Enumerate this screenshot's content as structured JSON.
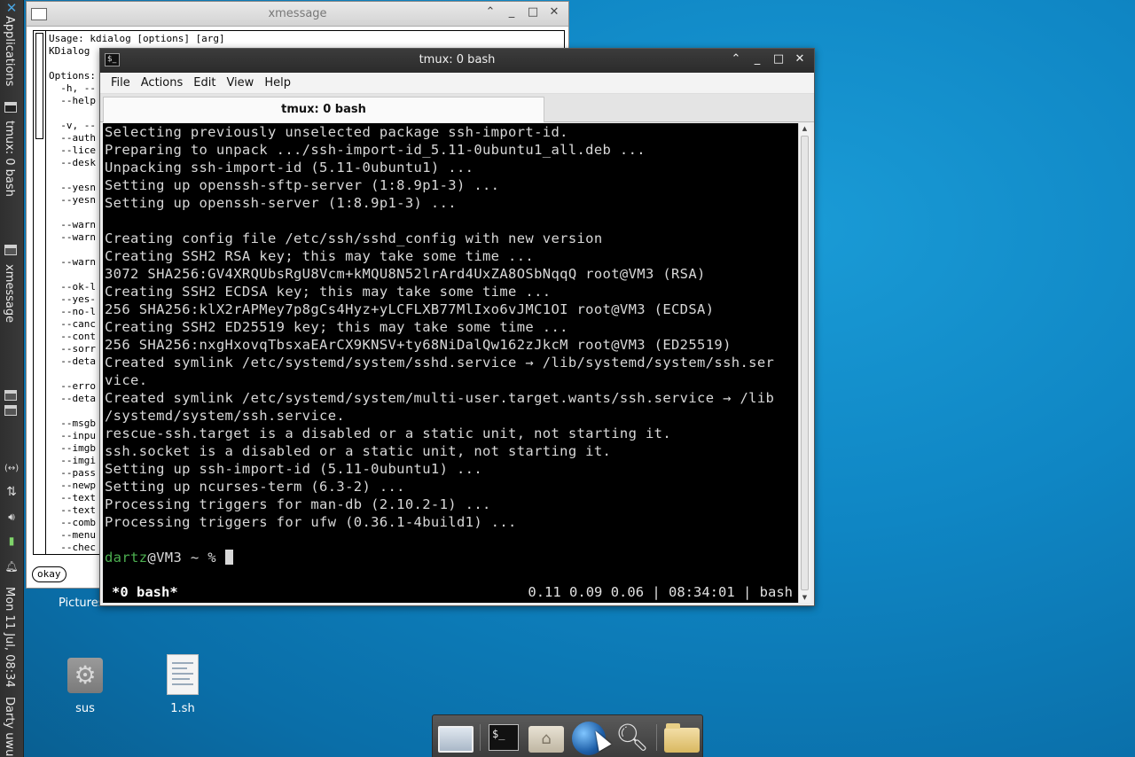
{
  "left_panel": {
    "applications_label": "Applications",
    "task_tmux": "tmux: 0 bash",
    "task_xmessage": "xmessage",
    "arrows_icon": "(↔)",
    "clock": "Mon 11 Jul, 08:34",
    "user": "Darty uwu"
  },
  "desktop": {
    "icons": [
      {
        "label": "Pictures"
      },
      {
        "label": "sus"
      },
      {
        "label": "1.sh"
      }
    ]
  },
  "xmessage": {
    "title": "xmessage",
    "okay_label": "okay",
    "text": "Usage: kdialog [options] [arg]\nKDialog\n\nOptions:\n  -h, --\n  --help\n\n  -v, --\n  --auth\n  --lice\n  --desk\n\n  --yesn\n  --yesn\n\n  --warn\n  --warn\n\n  --warn\n\n  --ok-l\n  --yes-\n  --no-l\n  --canc\n  --cont\n  --sorr\n  --deta\n\n  --erro\n  --deta\n\n  --msgb\n  --inpu\n  --imgb\n  --imgi\n  --pass\n  --newp\n  --text\n  --text\n  --comb\n  --menu\n  --chec"
  },
  "terminal": {
    "title": "tmux: 0 bash",
    "menu": [
      "File",
      "Actions",
      "Edit",
      "View",
      "Help"
    ],
    "tab_label": "tmux: 0 bash",
    "lines": [
      "Selecting previously unselected package ssh-import-id.",
      "Preparing to unpack .../ssh-import-id_5.11-0ubuntu1_all.deb ...",
      "Unpacking ssh-import-id (5.11-0ubuntu1) ...",
      "Setting up openssh-sftp-server (1:8.9p1-3) ...",
      "Setting up openssh-server (1:8.9p1-3) ...",
      "",
      "Creating config file /etc/ssh/sshd_config with new version",
      "Creating SSH2 RSA key; this may take some time ...",
      "3072 SHA256:GV4XRQUbsRgU8Vcm+kMQU8N52lrArd4UxZA8OSbNqqQ root@VM3 (RSA)",
      "Creating SSH2 ECDSA key; this may take some time ...",
      "256 SHA256:klX2rAPMey7p8gCs4Hyz+yLCFLXB77MlIxo6vJMC1OI root@VM3 (ECDSA)",
      "Creating SSH2 ED25519 key; this may take some time ...",
      "256 SHA256:nxgHxovqTbsxaEArCX9KNSV+ty68NiDalQw162zJkcM root@VM3 (ED25519)",
      "Created symlink /etc/systemd/system/sshd.service → /lib/systemd/system/ssh.ser",
      "vice.",
      "Created symlink /etc/systemd/system/multi-user.target.wants/ssh.service → /lib",
      "/systemd/system/ssh.service.",
      "rescue-ssh.target is a disabled or a static unit, not starting it.",
      "ssh.socket is a disabled or a static unit, not starting it.",
      "Setting up ssh-import-id (5.11-0ubuntu1) ...",
      "Setting up ncurses-term (6.3-2) ...",
      "Processing triggers for man-db (2.10.2-1) ...",
      "Processing triggers for ufw (0.36.1-4build1) ...",
      ""
    ],
    "prompt_user": "dartz",
    "prompt_host": "@VM3 ~ % ",
    "status_left": "*0 bash*",
    "status_right": "0.11 0.09 0.06 | 08:34:01 | bash"
  },
  "dock": {
    "items": [
      "desktop-icon",
      "terminal-icon",
      "home-folder-icon",
      "web-browser-icon",
      "search-icon",
      "folder-icon"
    ]
  }
}
